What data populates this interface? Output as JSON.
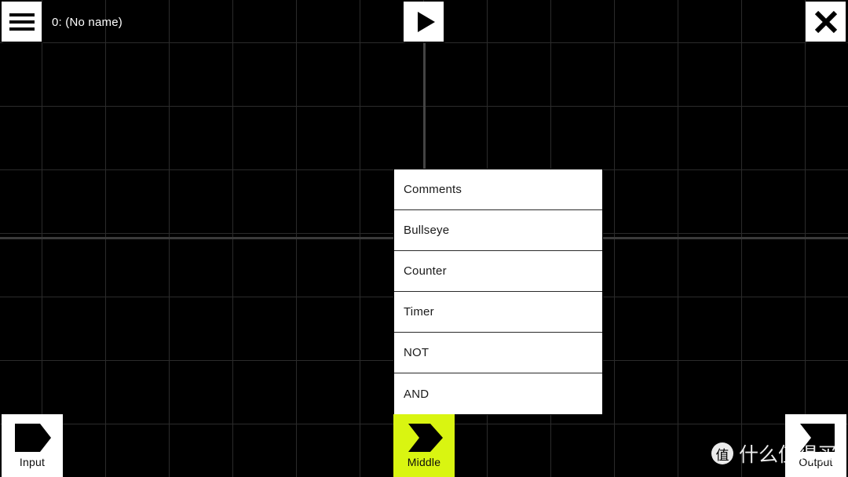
{
  "app": {
    "background_color": "#000000",
    "grid_line_color": "#2b2b2b",
    "accent_color": "#d9f511"
  },
  "header": {
    "menu_button_name": "hamburger-menu-icon",
    "title": "0: (No name)",
    "run_button_icon": "play-icon",
    "close_button_icon": "close-icon"
  },
  "component_menu": {
    "items": [
      {
        "label": "Comments"
      },
      {
        "label": "Bullseye"
      },
      {
        "label": "Counter"
      },
      {
        "label": "Timer"
      },
      {
        "label": "NOT"
      },
      {
        "label": "AND"
      }
    ]
  },
  "nodes": [
    {
      "id": "input",
      "label": "Input",
      "icon": "input-node-icon",
      "selected": false
    },
    {
      "id": "middle",
      "label": "Middle",
      "icon": "middle-node-icon",
      "selected": true
    },
    {
      "id": "output",
      "label": "Output",
      "icon": "output-node-icon",
      "selected": false
    }
  ],
  "watermark": {
    "logo_glyph": "值",
    "text": "什么值得买"
  }
}
